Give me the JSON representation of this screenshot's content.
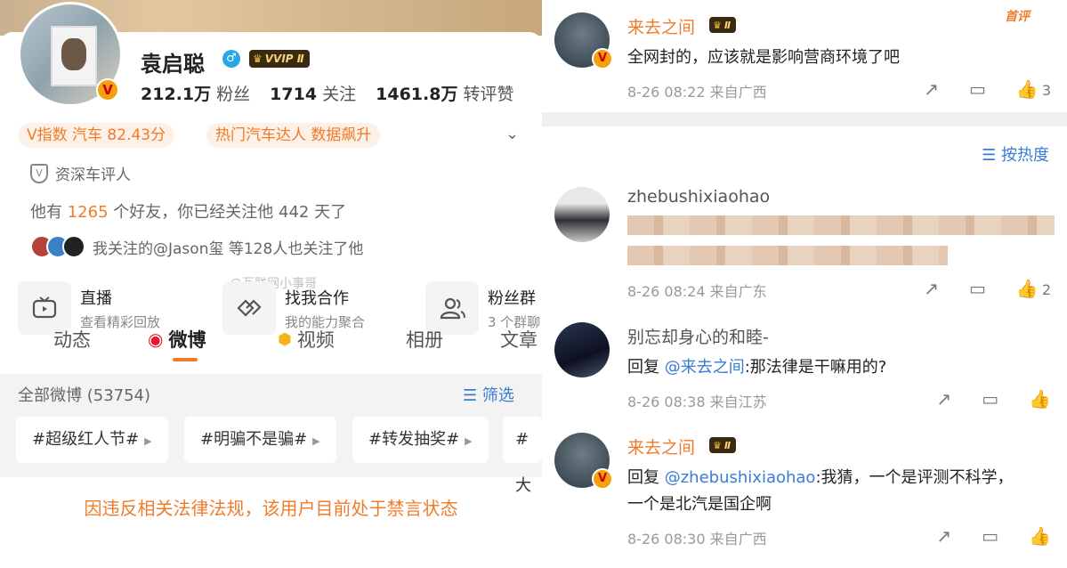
{
  "profile": {
    "name": "袁启聪",
    "vip_label": "VVIP Ⅱ",
    "fans": {
      "value": "212.1万",
      "label": "粉丝"
    },
    "following": {
      "value": "1714",
      "label": "关注"
    },
    "likes": {
      "value": "1461.8万",
      "label": "转评赞"
    },
    "tag1": "V指数 汽车 82.43分",
    "tag2": "热门汽车达人 数据飙升",
    "verify": "资深车评人",
    "friends_prefix": "他有",
    "friends_count": "1265",
    "friends_suffix": "个好友，你已经关注他 442 天了",
    "mutual": "我关注的@Jason玺  等128人也关注了他",
    "watermark": "@互联网小事哥",
    "features": [
      {
        "title": "直播",
        "sub": "查看精彩回放",
        "icon": "tv-icon"
      },
      {
        "title": "找我合作",
        "sub": "我的能力聚合",
        "icon": "handshake-icon"
      },
      {
        "title": "粉丝群",
        "sub": "3 个群聊",
        "icon": "group-icon"
      }
    ],
    "tabs": [
      "动态",
      "微博",
      "视频",
      "相册",
      "文章"
    ],
    "all_weibo": "全部微博 (53754)",
    "filter": "筛选",
    "chips": [
      "#超级红人节#",
      "#明骗不是骗#",
      "#转发抽奖#",
      "#大"
    ],
    "banned": "因违反相关法律法规，该用户目前处于禁言状态"
  },
  "comments": {
    "sort": "按热度",
    "hot_label": "首评",
    "items": [
      {
        "name": "来去之间",
        "text": "全网封的，应该就是影响营商环境了吧",
        "time": "8-26 08:22",
        "loc": "来自广西",
        "likes": "3"
      },
      {
        "name": "zhebushixiaohao",
        "text": "",
        "time": "8-26 08:24",
        "loc": "来自广东",
        "likes": "2"
      },
      {
        "name": "别忘却身心的和睦-",
        "reply_prefix": "回复",
        "reply_to": "@来去之间",
        "text": ":那法律是干嘛用的?",
        "time": "8-26 08:38",
        "loc": "来自江苏",
        "likes": ""
      },
      {
        "name": "来去之间",
        "reply_prefix": "回复",
        "reply_to": "@zhebushixiaohao",
        "text": ":我猜，一个是评测不科学，",
        "text2": "一个是北汽是国企啊",
        "time": "8-26 08:30",
        "loc": "来自广西",
        "likes": ""
      }
    ]
  },
  "colors": {
    "accent": "#f07b2a",
    "link": "#3a7bd5"
  }
}
